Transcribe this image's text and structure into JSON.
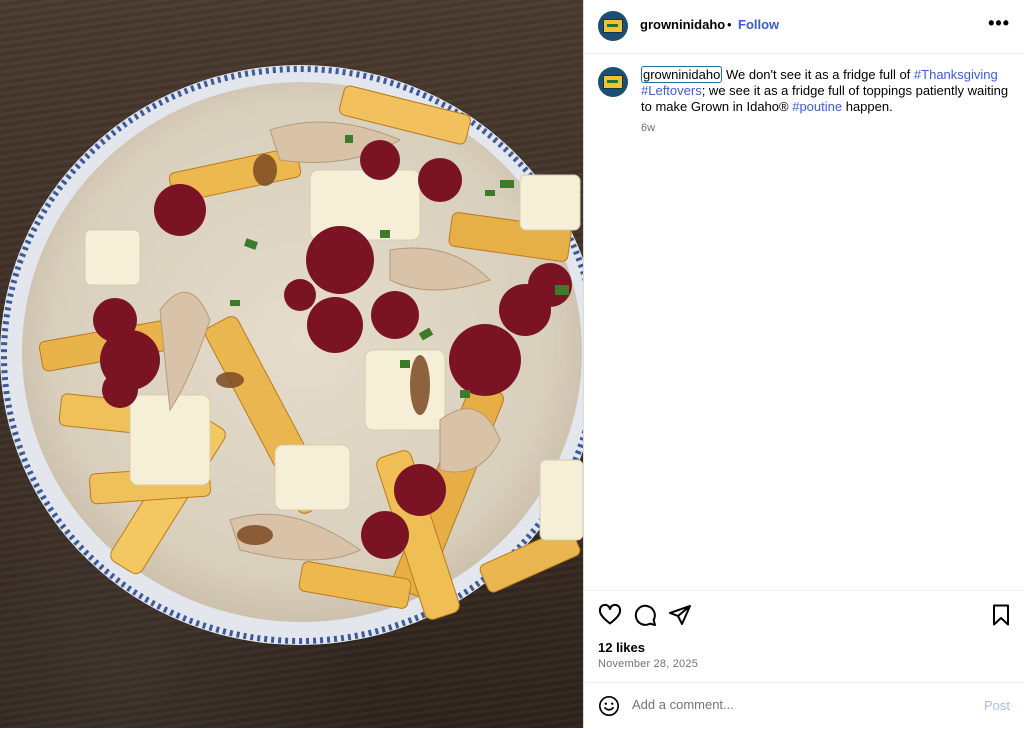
{
  "photo": {
    "subject": "poutine-bowl"
  },
  "header": {
    "username": "growninidaho",
    "separator": "•",
    "follow_label": "Follow",
    "more_label": "•••"
  },
  "caption": {
    "username": "growninidaho",
    "text_1": " We don't see it as a fridge full of ",
    "tag_1": "#Thanksgiving",
    "tag_2": "#Leftovers",
    "text_2": "; we see it as a fridge full of toppings patiently waiting to make Grown in Idaho® ",
    "tag_3": "#poutine",
    "text_3": " happen.",
    "time": "6w"
  },
  "actions": {
    "icons": [
      "heart-icon",
      "comment-icon",
      "share-icon",
      "bookmark-icon"
    ],
    "likes": "12 likes",
    "date": "November 28, 2025"
  },
  "comment": {
    "placeholder": "Add a comment...",
    "post_label": "Post"
  },
  "colors": {
    "link": "#3b5bdb",
    "avatar_bg": "#1d4f73",
    "muted": "#737373"
  }
}
